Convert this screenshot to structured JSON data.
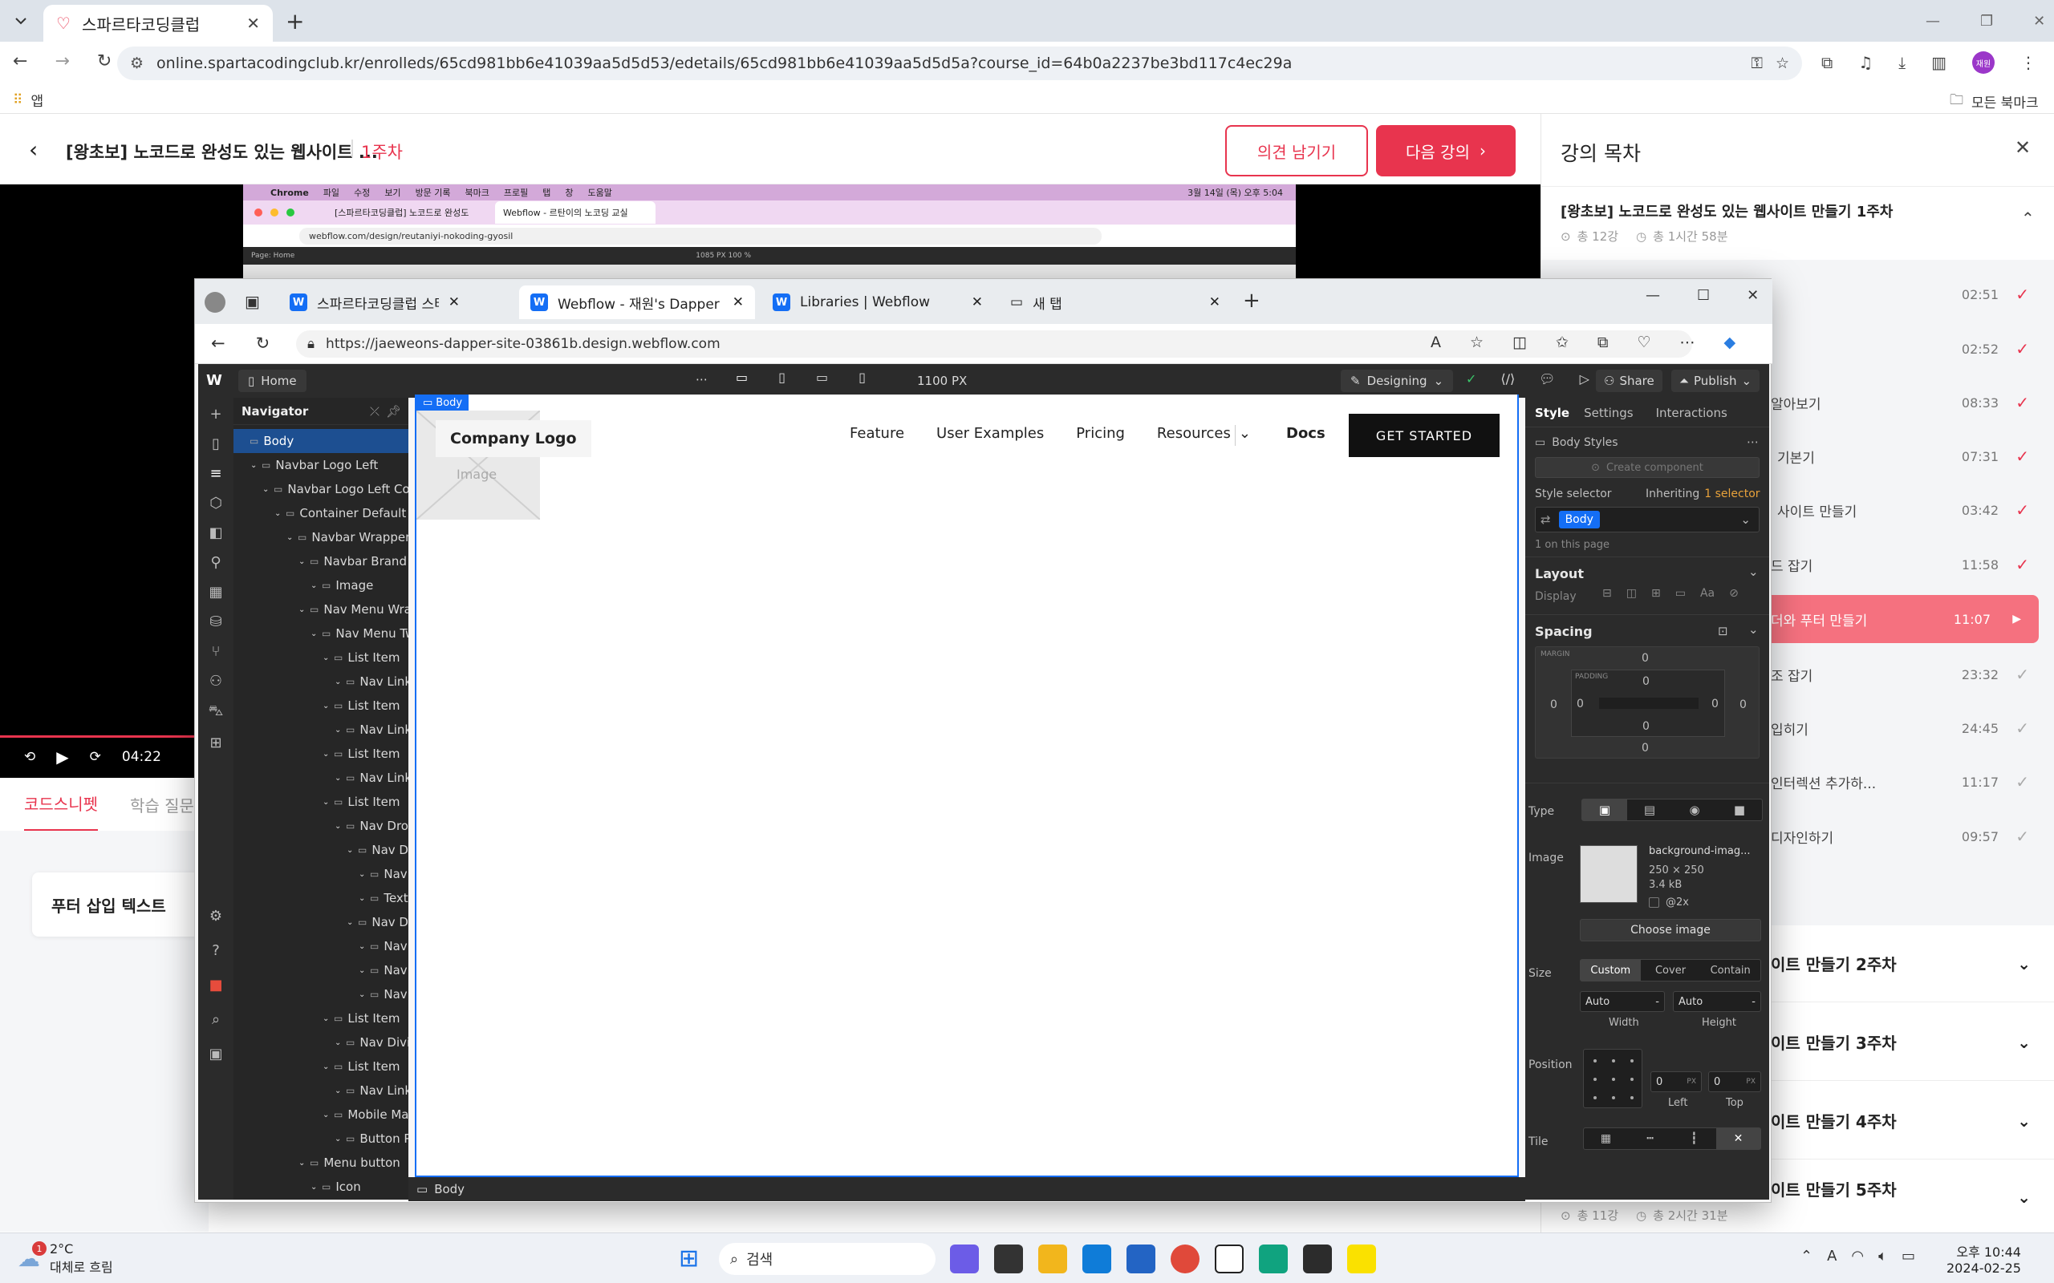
{
  "browser": {
    "tab_title": "스파르타코딩클럽",
    "url": "online.spartacodingclub.kr/enrolleds/65cd981bb6e41039aa5d5d53/edetails/65cd981bb6e41039aa5d5d5a?course_id=64b0a2237be3bd117c4ec29a",
    "bookmark_apps": "앱",
    "bookmark_all": "모든 북마크",
    "profile_initials": "재원"
  },
  "course": {
    "title": "[왕초보] 노코드로 완성도 있는 웹사이트 ...",
    "week": "1주차",
    "feedback_button": "의견 남기기",
    "next_button": "다음 강의",
    "video_time": "04:22",
    "tab_snippet": "코드스니펫",
    "tab_qna": "학습 질문",
    "snippet_text": "푸터 삽입 텍스트"
  },
  "mac": {
    "menu": [
      "Chrome",
      "파일",
      "수정",
      "보기",
      "방문 기록",
      "북마크",
      "프로필",
      "탭",
      "창",
      "도움말"
    ],
    "clock": "3월 14일 (목) 오후 5:04",
    "tab1": "[스파르타코딩클럽] 노코드로 완성도",
    "tab2": "Webflow - 르탄이의 노코딩 교실",
    "url": "webflow.com/design/reutaniyi-nokoding-gyosil",
    "page_label": "Page: Home",
    "zoom": "1085 PX  100 %"
  },
  "toc": {
    "heading": "강의 목차",
    "week1_title": "[왕초보] 노코드로 완성도 있는 웹사이트 만들기 1주차",
    "week1_meta_count": "총 12강",
    "week1_meta_time": "총 1시간 58분",
    "lessons": [
      {
        "title": "",
        "time": "02:51"
      },
      {
        "title": "",
        "time": "02:52"
      },
      {
        "title": "알아보기",
        "time": "08:33"
      },
      {
        "title": "기본기",
        "time": "07:31"
      },
      {
        "title": "사이트 만들기",
        "time": "03:42"
      },
      {
        "title": "드 잡기",
        "time": "11:58"
      },
      {
        "title": "더와 푸터 만들기",
        "time": "11:07"
      },
      {
        "title": "조 잡기",
        "time": "23:32"
      },
      {
        "title": "입히기",
        "time": "24:45"
      },
      {
        "title": "인터렉션 추가하...",
        "time": "11:17"
      },
      {
        "title": "디자인하기",
        "time": "09:57"
      }
    ],
    "weeks": [
      "이트 만들기 2주차",
      "이트 만들기 3주차",
      "이트 만들기 4주차",
      "이트 만들기 5주차"
    ],
    "week5_meta_count": "총 11강",
    "week5_meta_time": "총 2시간 31분"
  },
  "edge": {
    "tabs": [
      "스파르타코딩클럽 스타일 가이드",
      "Webflow - 재원's Dapper Site",
      "Libraries | Webflow",
      "새 탭"
    ],
    "url": "https://jaeweons-dapper-site-03861b.design.webflow.com"
  },
  "webflow": {
    "page": "Home",
    "width": "1100 PX",
    "mode": "Designing",
    "share": "Share",
    "publish": "Publish",
    "navigator_title": "Navigator",
    "tree": [
      {
        "label": "Body",
        "depth": 0
      },
      {
        "label": "Navbar Logo Left",
        "depth": 1
      },
      {
        "label": "Navbar Logo Left Cont",
        "depth": 2
      },
      {
        "label": "Container Default",
        "depth": 3
      },
      {
        "label": "Navbar Wrapper",
        "depth": 4
      },
      {
        "label": "Navbar Brand",
        "depth": 5
      },
      {
        "label": "Image",
        "depth": 6
      },
      {
        "label": "Nav Menu Wrap",
        "depth": 5
      },
      {
        "label": "Nav Menu Tw",
        "depth": 6
      },
      {
        "label": "List Item",
        "depth": 7
      },
      {
        "label": "Nav Link",
        "depth": 8
      },
      {
        "label": "List Item",
        "depth": 7
      },
      {
        "label": "Nav Link",
        "depth": 8
      },
      {
        "label": "List Item",
        "depth": 7
      },
      {
        "label": "Nav Link",
        "depth": 8
      },
      {
        "label": "List Item",
        "depth": 7
      },
      {
        "label": "Nav Drop",
        "depth": 8
      },
      {
        "label": "Nav Dr",
        "depth": 9
      },
      {
        "label": "Nav",
        "depth": 10
      },
      {
        "label": "Text",
        "depth": 10
      },
      {
        "label": "Nav Dr",
        "depth": 9
      },
      {
        "label": "Nav",
        "depth": 10
      },
      {
        "label": "Nav",
        "depth": 10
      },
      {
        "label": "Nav",
        "depth": 10
      },
      {
        "label": "List Item",
        "depth": 7
      },
      {
        "label": "Nav Divic",
        "depth": 8
      },
      {
        "label": "List Item",
        "depth": 7
      },
      {
        "label": "Nav Link",
        "depth": 8
      },
      {
        "label": "Mobile Mar",
        "depth": 7
      },
      {
        "label": "Button Pi",
        "depth": 8
      },
      {
        "label": "Menu button",
        "depth": 5
      },
      {
        "label": "Icon",
        "depth": 6
      }
    ],
    "canvas": {
      "body_tag": "Body",
      "logo": "Company Logo",
      "image_placeholder": "Image",
      "nav": [
        "Feature",
        "User Examples",
        "Pricing",
        "Resources"
      ],
      "docs": "Docs",
      "cta": "GET STARTED",
      "breadcrumb": "Body"
    },
    "style": {
      "tabs": [
        "Style",
        "Settings",
        "Interactions"
      ],
      "body_styles": "Body Styles",
      "create_component": "Create component",
      "selector_label": "Style selector",
      "inheriting": "Inheriting",
      "inheriting_count": "1 selector",
      "selector_value": "Body",
      "on_page": "1 on this page",
      "layout": "Layout",
      "display": "Display",
      "spacing": "Spacing",
      "margin_label": "MARGIN",
      "padding_label": "PADDING",
      "zero": "0",
      "type": "Type",
      "image_label": "Image",
      "image_name": "background-imag...",
      "image_dims": "250 × 250",
      "image_size": "3.4 kB",
      "at2x": "@2x",
      "choose_image": "Choose image",
      "size_label": "Size",
      "size_options": [
        "Custom",
        "Cover",
        "Contain"
      ],
      "auto": "Auto",
      "width": "Width",
      "height": "Height",
      "position": "Position",
      "px": "PX",
      "left": "Left",
      "top": "Top",
      "tile": "Tile"
    }
  },
  "taskbar": {
    "weather_temp": "2°C",
    "weather_desc": "대체로 흐림",
    "search": "검색",
    "time": "오후 10:44",
    "date": "2024-02-25",
    "badge": "1"
  },
  "colors": {
    "accent": "#e8344e",
    "webflow_blue": "#146ef5",
    "dark_panel": "#2b2b2b"
  }
}
